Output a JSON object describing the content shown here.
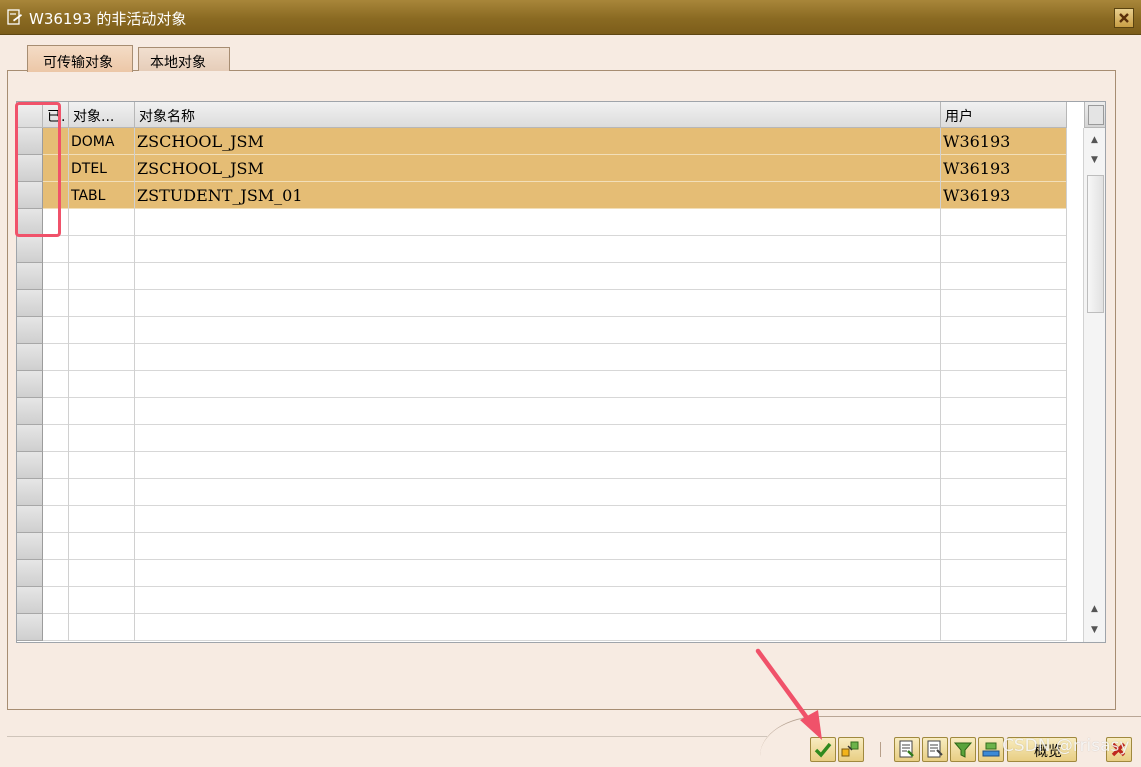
{
  "window": {
    "title": "W36193 的非活动对象",
    "icon": "edit-document-icon",
    "close_icon": "close-icon"
  },
  "tabs": [
    {
      "label": "可传输对象",
      "active": true
    },
    {
      "label": "本地对象",
      "active": false
    }
  ],
  "table": {
    "headers": [
      "已.",
      "对象...",
      "对象名称",
      "用户"
    ],
    "rows": [
      {
        "type": "DOMA",
        "name": "ZSCHOOL_JSM",
        "user": "W36193"
      },
      {
        "type": "DTEL",
        "name": "ZSCHOOL_JSM",
        "user": "W36193"
      },
      {
        "type": "TABL",
        "name": "ZSTUDENT_JSM_01",
        "user": "W36193"
      }
    ],
    "row_fill_color": "#e5bd75"
  },
  "toolbar": {
    "confirm_icon": "checkmark-icon",
    "activate_icon": "activate-objects-icon",
    "overview_label": "概览",
    "cancel_icon": "cancel-icon"
  },
  "annotations": {
    "highlight_color": "#f0526a"
  },
  "watermark": "CSDN @rrisasy"
}
